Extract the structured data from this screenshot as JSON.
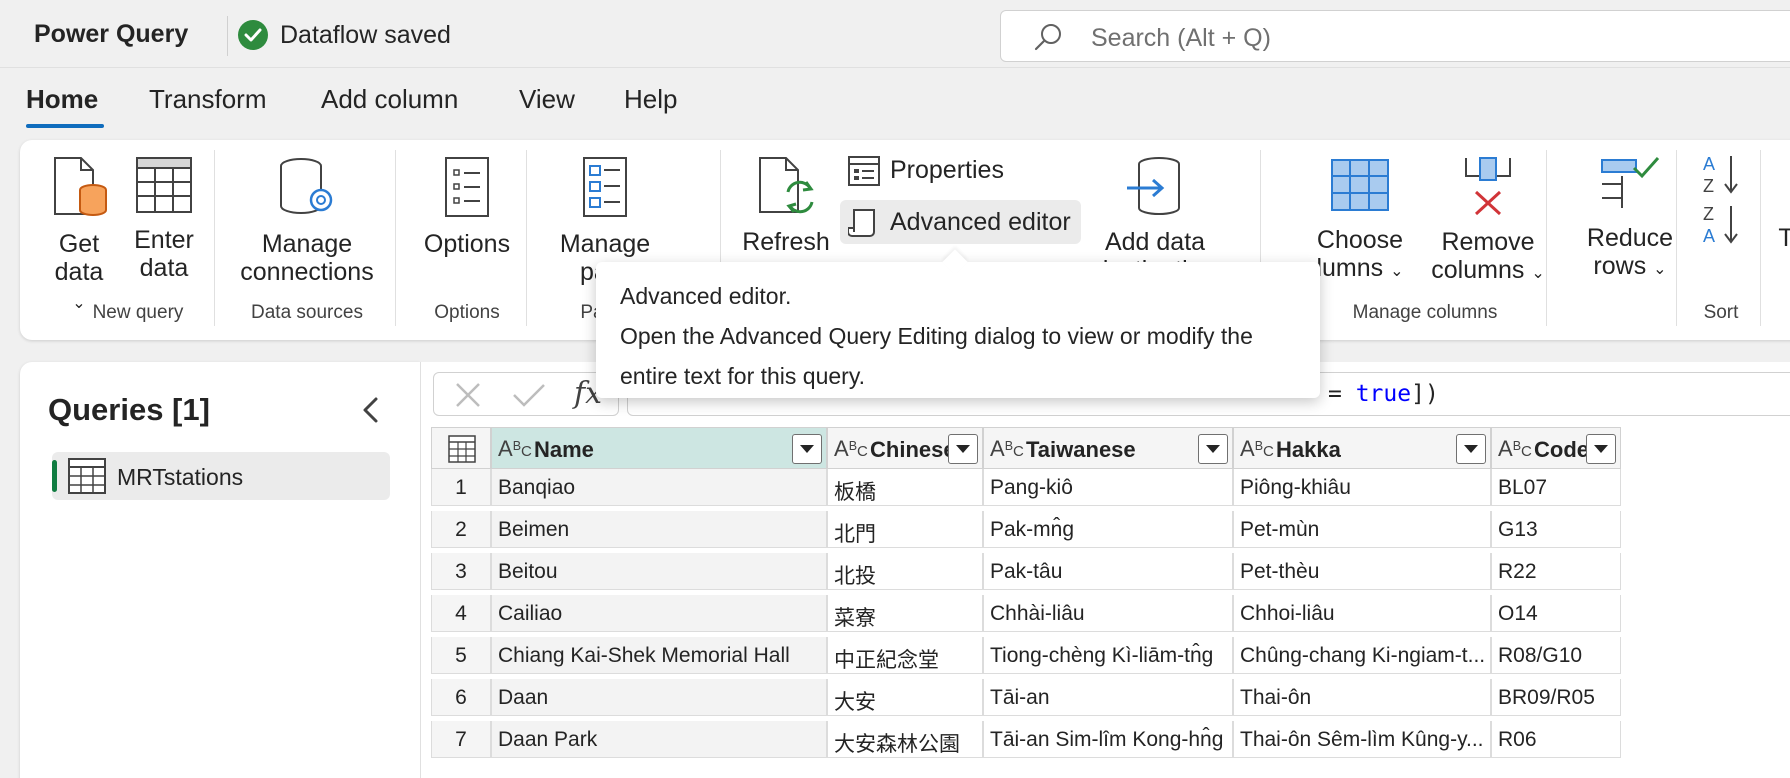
{
  "titlebar": {
    "app_name": "Power Query",
    "status": "Dataflow saved",
    "search_placeholder": "Search (Alt + Q)"
  },
  "tabs": [
    "Home",
    "Transform",
    "Add column",
    "View",
    "Help"
  ],
  "active_tab": "Home",
  "ribbon": {
    "get_data": "Get",
    "get_data_2": "data",
    "enter_data": "Enter",
    "enter_data_2": "data",
    "group_new_query": "New query",
    "manage_connections": "Manage",
    "manage_connections_2": "connections",
    "group_data_sources": "Data sources",
    "options": "Options",
    "group_options": "Options",
    "manage_params": "Manage",
    "manage_params_2": "para",
    "group_params": "Pa",
    "refresh": "Refresh",
    "properties": "Properties",
    "advanced_editor": "Advanced editor",
    "add_destination": "Add data",
    "add_destination_2": "destination",
    "choose_columns": "Choose",
    "choose_columns_2": "lumns",
    "remove_columns": "Remove",
    "remove_columns_2": "columns",
    "group_manage_columns": "Manage columns",
    "reduce_rows": "Reduce",
    "reduce_rows_2": "rows",
    "group_sort": "Sort",
    "cut_letter": "T"
  },
  "tooltip": {
    "title": "Advanced editor.",
    "body": "Open the Advanced Query Editing dialog to view or modify the entire text for this query."
  },
  "queries": {
    "title": "Queries [1]",
    "items": [
      "MRTstations"
    ]
  },
  "formula": {
    "prefix": "= ",
    "keyword": "true",
    "suffix": "])"
  },
  "grid": {
    "columns": [
      "Name",
      "Chinese",
      "Taiwanese",
      "Hakka",
      "Code"
    ],
    "rows": [
      {
        "n": "1",
        "name": "Banqiao",
        "chinese": "板橋",
        "taiwanese": "Pang-kiô",
        "hakka": "Piông-khiâu",
        "code": "BL07"
      },
      {
        "n": "2",
        "name": "Beimen",
        "chinese": "北門",
        "taiwanese": "Pak-mn̂g",
        "hakka": "Pet-mùn",
        "code": "G13"
      },
      {
        "n": "3",
        "name": "Beitou",
        "chinese": "北投",
        "taiwanese": "Pak-tâu",
        "hakka": "Pet-thèu",
        "code": "R22"
      },
      {
        "n": "4",
        "name": "Cailiao",
        "chinese": "菜寮",
        "taiwanese": "Chhài-liâu",
        "hakka": "Chhoi-liâu",
        "code": "O14"
      },
      {
        "n": "5",
        "name": "Chiang Kai-Shek Memorial Hall",
        "chinese": "中正紀念堂",
        "taiwanese": "Tiong-chèng Kì-liām-tn̂g",
        "hakka": "Chûng-chang Ki-ngiam-t...",
        "code": "R08/G10"
      },
      {
        "n": "6",
        "name": "Daan",
        "chinese": "大安",
        "taiwanese": "Tāi-an",
        "hakka": "Thai-ôn",
        "code": "BR09/R05"
      },
      {
        "n": "7",
        "name": "Daan Park",
        "chinese": "大安森林公園",
        "taiwanese": "Tāi-an Sim-lîm Kong-hn̂g",
        "hakka": "Thai-ôn Sêm-lìm Kûng-y...",
        "code": "R06"
      }
    ]
  }
}
